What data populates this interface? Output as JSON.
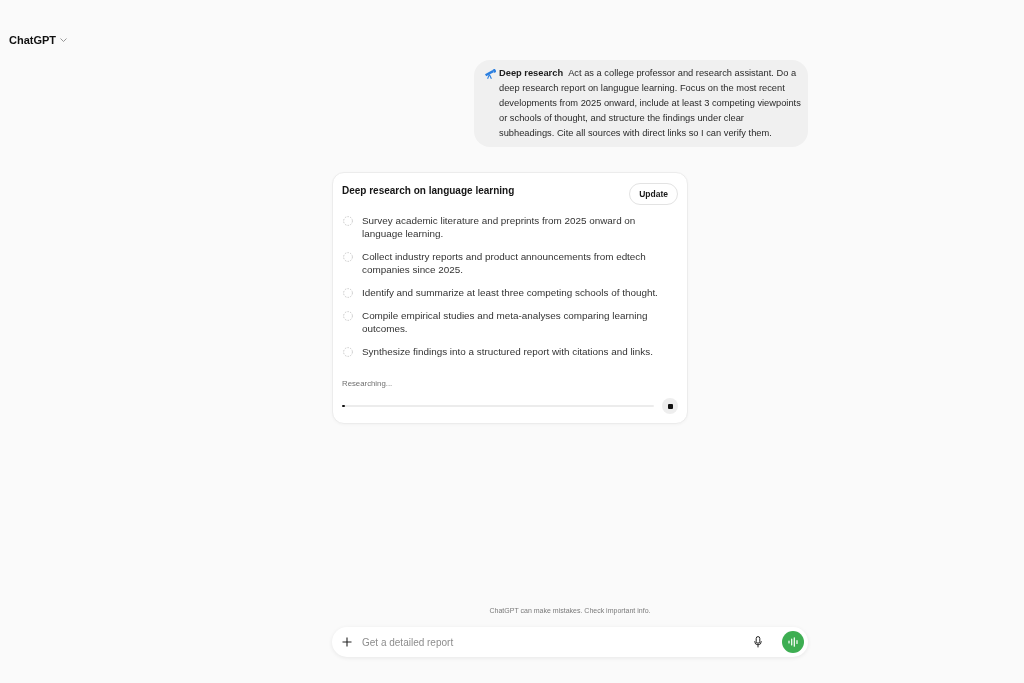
{
  "header": {
    "title": "ChatGPT"
  },
  "user_message": {
    "text": "**Deep research** Act as a college professor and research assistant. Do a deep research report on langugue learning. Focus on the most recent developments from 2025 onward, include at least 3 competing viewpoints or schools of thought, and structure the findings under clear subheadings. Cite all sources with direct links so I can verify them."
  },
  "research_card": {
    "title": "Deep research on language learning",
    "update_button": "Update",
    "steps": [
      {
        "text": "Survey academic literature and preprints from 2025 onward on language learning.",
        "done": false
      },
      {
        "text": "Collect industry reports and product announcements from edtech companies since 2025.",
        "done": false
      },
      {
        "text": "Identify and summarize at least three competing schools of thought.",
        "done": false
      },
      {
        "text": "Compile empirical studies and meta-analyses comparing learning outcomes.",
        "done": false
      },
      {
        "text": "Synthesize findings into a structured report with citations and links.",
        "done": false
      }
    ],
    "status": "Researching...",
    "progress": {
      "level": 0.01
    }
  },
  "disclaimer": "ChatGPT can make mistakes. Check important info.",
  "composer": {
    "placeholder": "Get a detailed report"
  }
}
